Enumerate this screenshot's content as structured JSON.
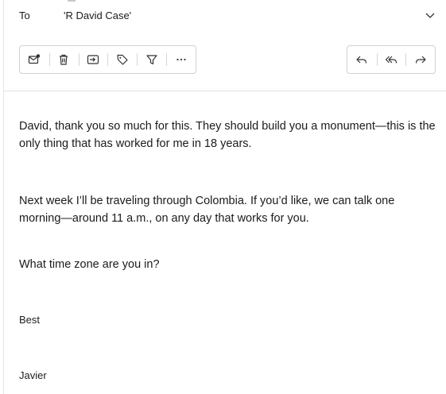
{
  "header": {
    "to_label": "To",
    "to_value": "'R David Case'"
  },
  "toolbar": {
    "left_buttons": [
      {
        "icon": "mark-unread-icon",
        "label": "Mark as unread"
      },
      {
        "icon": "delete-icon",
        "label": "Delete"
      },
      {
        "icon": "move-to-icon",
        "label": "Move to"
      },
      {
        "icon": "tag-icon",
        "label": "Categorize"
      },
      {
        "icon": "filter-icon",
        "label": "Filter"
      },
      {
        "icon": "more-icon",
        "label": "More actions"
      }
    ],
    "right_buttons": [
      {
        "icon": "reply-icon",
        "label": "Reply"
      },
      {
        "icon": "reply-all-icon",
        "label": "Reply all"
      },
      {
        "icon": "forward-icon",
        "label": "Forward"
      }
    ]
  },
  "message": {
    "p1": "David, thank you so much for this. They should build you a monument—this is the only thing that has worked for me in 18 years.",
    "p2": "Next week I’ll be traveling through Colombia. If you’d like, we can talk one morning—around 11 a.m., on any day that works for you.",
    "p3": "What time zone are you in?",
    "closing": "Best",
    "signature": "Javier"
  }
}
